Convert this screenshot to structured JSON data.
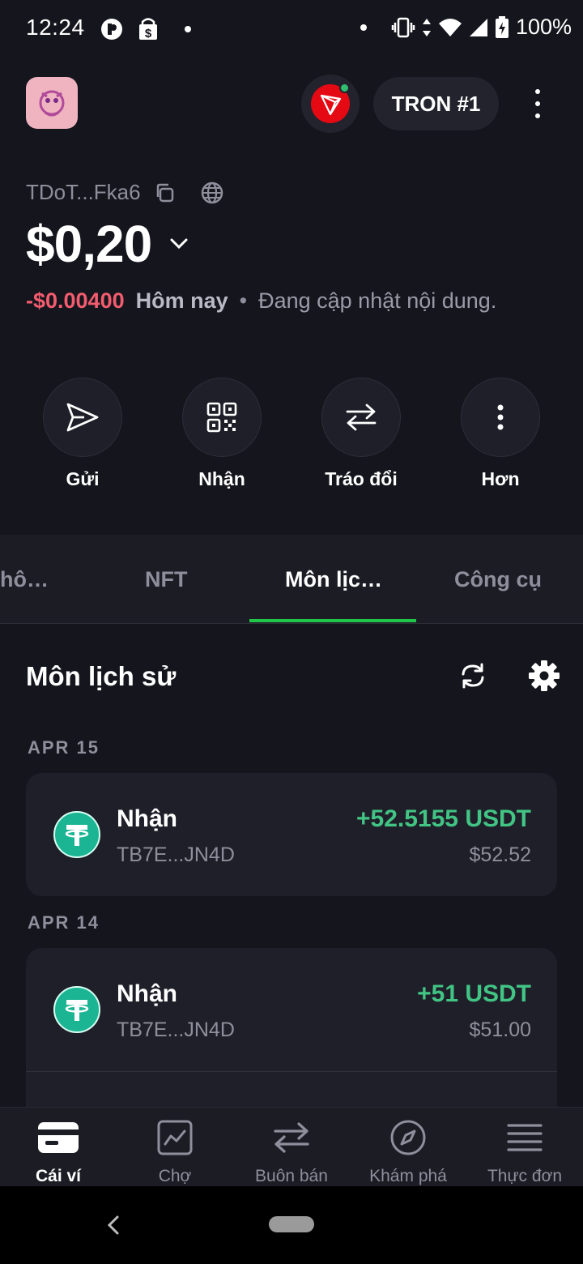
{
  "status_bar": {
    "time": "12:24",
    "battery": "100%"
  },
  "header": {
    "network_name": "TRON #1"
  },
  "wallet": {
    "address": "TDoT...Fka6",
    "balance": "$0,20",
    "change": "-$0.00400",
    "period": "Hôm nay",
    "status": "Đang cập nhật nội dung."
  },
  "actions": [
    {
      "label": "Gửi",
      "icon": "send-icon"
    },
    {
      "label": "Nhận",
      "icon": "qr-code-icon"
    },
    {
      "label": "Tráo đổi",
      "icon": "swap-icon"
    },
    {
      "label": "Hơn",
      "icon": "more-vertical-icon"
    }
  ],
  "tabs": [
    {
      "label": "hô…",
      "active": false
    },
    {
      "label": "NFT",
      "active": false
    },
    {
      "label": "Môn lịc…",
      "active": true
    },
    {
      "label": "Công cụ",
      "active": false
    }
  ],
  "history": {
    "title": "Môn lịch sử",
    "groups": [
      {
        "date": "APR 15",
        "items": [
          {
            "title": "Nhận",
            "address": "TB7E...JN4D",
            "amount": "+52.5155 USDT",
            "usd": "$52.52",
            "icon": "tether-icon"
          }
        ]
      },
      {
        "date": "APR 14",
        "items": [
          {
            "title": "Nhận",
            "address": "TB7E...JN4D",
            "amount": "+51 USDT",
            "usd": "$51.00",
            "icon": "tether-icon"
          }
        ]
      }
    ]
  },
  "bottom_nav": [
    {
      "label": "Cái ví",
      "icon": "wallet-icon",
      "active": true
    },
    {
      "label": "Chợ",
      "icon": "market-chart-icon",
      "active": false
    },
    {
      "label": "Buôn bán",
      "icon": "trade-arrows-icon",
      "active": false
    },
    {
      "label": "Khám phá",
      "icon": "compass-icon",
      "active": false
    },
    {
      "label": "Thực đơn",
      "icon": "menu-icon",
      "active": false
    }
  ],
  "colors": {
    "background": "#15151d",
    "card": "#1f1f29",
    "positive": "#41c484",
    "negative": "#f25c6e",
    "accent_underline": "#20c648",
    "tron_red": "#e50914",
    "tether": "#1bb594"
  }
}
